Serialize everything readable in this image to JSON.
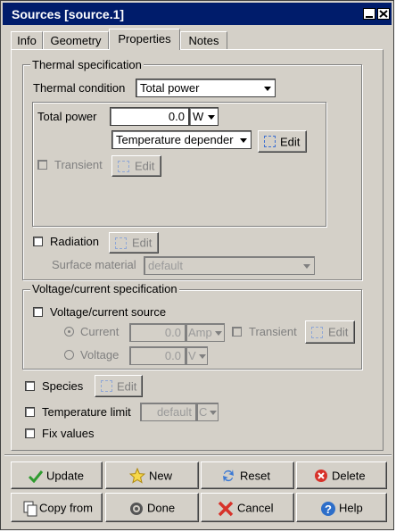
{
  "window": {
    "title": "Sources [source.1]"
  },
  "tabs": [
    {
      "label": "Info"
    },
    {
      "label": "Geometry"
    },
    {
      "label": "Properties"
    },
    {
      "label": "Notes"
    }
  ],
  "active_tab": "Properties",
  "thermal": {
    "legend": "Thermal specification",
    "condition_label": "Thermal condition",
    "condition_value": "Total power",
    "total_power_label": "Total power",
    "total_power_value": "0.0",
    "total_power_unit": "W",
    "dependence_value": "Temperature depender",
    "edit_label": "Edit",
    "transient_label": "Transient",
    "transient_edit_label": "Edit",
    "radiation_label": "Radiation",
    "radiation_edit_label": "Edit",
    "surface_material_label": "Surface material",
    "surface_material_value": "default"
  },
  "voltage": {
    "legend": "Voltage/current specification",
    "source_label": "Voltage/current source",
    "current_label": "Current",
    "current_value": "0.0",
    "current_unit": "Amp",
    "transient_label": "Transient",
    "edit_label": "Edit",
    "voltage_label": "Voltage",
    "voltage_value": "0.0",
    "voltage_unit": "V"
  },
  "species": {
    "label": "Species",
    "edit_label": "Edit"
  },
  "temp_limit": {
    "label": "Temperature limit",
    "value": "default",
    "unit": "C"
  },
  "fix_values": {
    "label": "Fix values"
  },
  "buttons": {
    "update": "Update",
    "new": "New",
    "reset": "Reset",
    "delete": "Delete",
    "copy_from": "Copy from",
    "done": "Done",
    "cancel": "Cancel",
    "help": "Help"
  }
}
